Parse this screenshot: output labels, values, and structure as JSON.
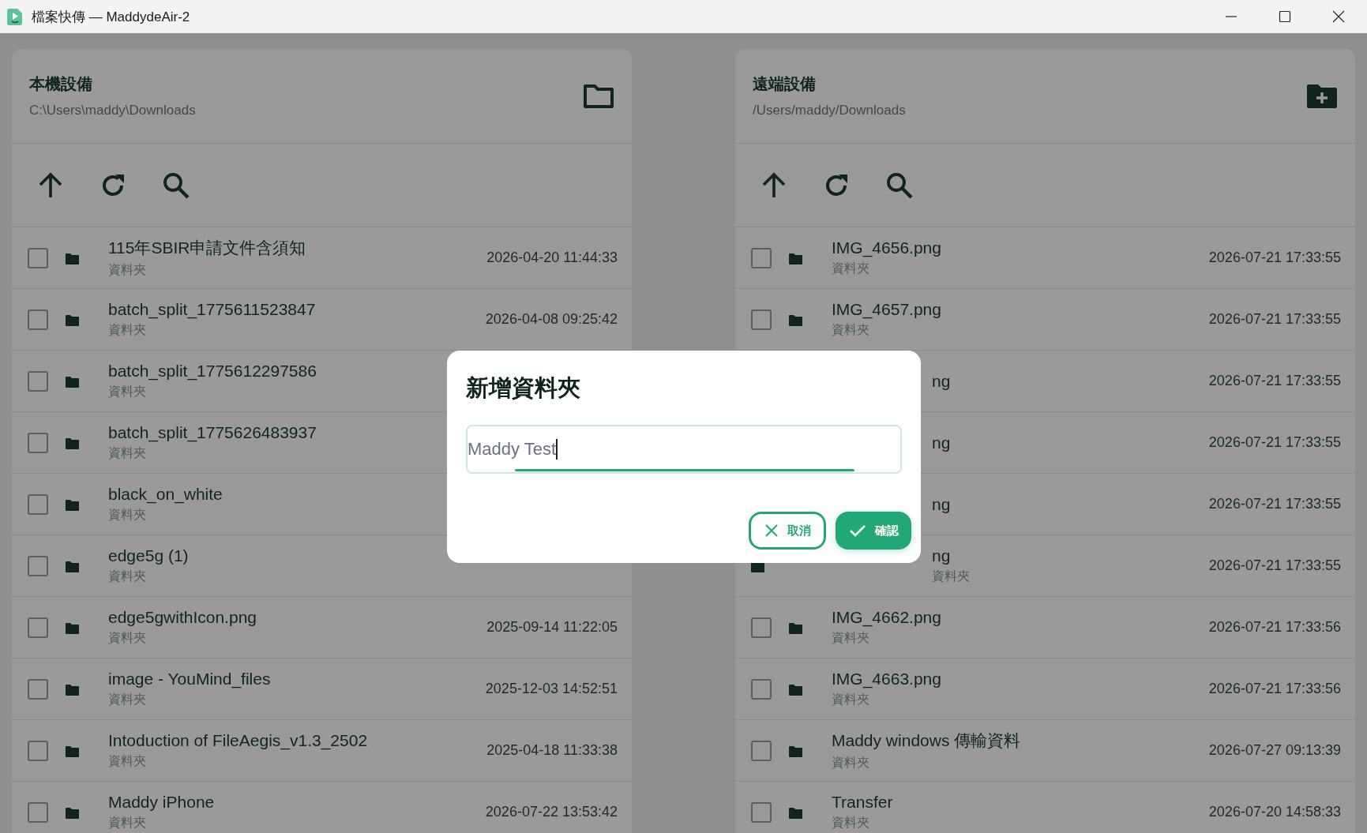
{
  "window": {
    "title": "檔案快傳 — MaddydeAir-2"
  },
  "panels": [
    {
      "title": "本機設備",
      "path": "C:\\Users\\maddy\\Downloads",
      "kind": "folder",
      "rows": [
        {
          "name": "115年SBIR申請文件含須知",
          "type": "資料夾",
          "date": "2026-04-20 11:44:33",
          "checked": false
        },
        {
          "name": "batch_split_1775611523847",
          "type": "資料夾",
          "date": "2026-04-08 09:25:42",
          "checked": false
        },
        {
          "name": "batch_split_1775612297586",
          "type": "資料夾",
          "checked": false
        },
        {
          "name": "batch_split_1775626483937",
          "type": "資料夾",
          "checked": false
        },
        {
          "name": "black_on_white",
          "type": "資料夾",
          "checked": false
        },
        {
          "name": "edge5g (1)",
          "type": "資料夾",
          "checked": false
        },
        {
          "name": "edge5gwithIcon.png",
          "type": "資料夾",
          "date": "2025-09-14 11:22:05",
          "checked": false
        },
        {
          "name": "image - YouMind_files",
          "type": "資料夾",
          "date": "2025-12-03 14:52:51",
          "checked": false
        },
        {
          "name": "Intoduction of FileAegis_v1.3_2502",
          "type": "資料夾",
          "date": "2025-04-18 11:33:38",
          "checked": false
        },
        {
          "name": "Maddy iPhone",
          "type": "資料夾",
          "date": "2026-07-22 13:53:42",
          "checked": false
        }
      ]
    },
    {
      "title": "遠端設備",
      "path": "/Users/maddy/Downloads",
      "kind": "folder-plus",
      "rows": [
        {
          "name": "IMG_4656.png",
          "type": "資料夾",
          "date": "2026-07-21 17:33:55",
          "checked": false
        },
        {
          "name": "IMG_4657.png",
          "type": "資料夾",
          "date": "2026-07-21 17:33:55",
          "checked": false
        },
        {
          "name": "ng",
          "cut": true,
          "date": "2026-07-21 17:33:55"
        },
        {
          "name": "ng",
          "cut": true,
          "date": "2026-07-21 17:33:55"
        },
        {
          "name": "ng",
          "cut": true,
          "date": "2026-07-21 17:33:55"
        },
        {
          "name": "ng",
          "cut": true,
          "type": "資料夾",
          "date": "2026-07-21 17:33:55"
        },
        {
          "name": "IMG_4662.png",
          "type": "資料夾",
          "date": "2026-07-21 17:33:56",
          "checked": false
        },
        {
          "name": "IMG_4663.png",
          "type": "資料夾",
          "date": "2026-07-21 17:33:56",
          "checked": false
        },
        {
          "name": "Maddy windows 傳輸資料",
          "type": "資料夾",
          "date": "2026-07-27 09:13:39",
          "checked": false
        },
        {
          "name": "Transfer",
          "type": "資料夾",
          "date": "2026-07-20 14:58:33",
          "checked": false
        }
      ]
    }
  ],
  "dialog": {
    "title": "新增資料夾",
    "value": "Maddy Test",
    "buttons": [
      {
        "kind": "cancel",
        "label": "取消"
      },
      {
        "kind": "confirm",
        "label": "確認"
      }
    ]
  }
}
